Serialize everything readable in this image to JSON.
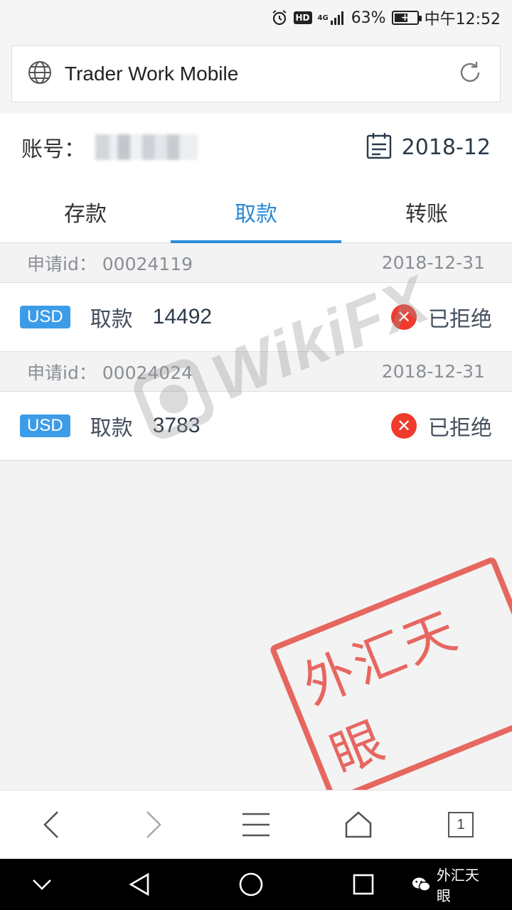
{
  "status_bar": {
    "network": "4G",
    "hd": "HD",
    "battery": "63%",
    "battery_level_percent": 63,
    "time": "中午12:52"
  },
  "browser": {
    "url_title": "Trader Work Mobile",
    "nav_buttons": [
      "back",
      "forward",
      "menu",
      "home",
      "tabs"
    ],
    "tab_count": "1"
  },
  "account": {
    "label": "账号：",
    "date": "2018-12"
  },
  "tabs": [
    {
      "label": "存款",
      "active": false
    },
    {
      "label": "取款",
      "active": true
    },
    {
      "label": "转账",
      "active": false
    }
  ],
  "records": [
    {
      "id_label": "申请id：",
      "id": "00024119",
      "date": "2018-12-31",
      "currency": "USD",
      "type": "取款",
      "amount": "14492",
      "status": "已拒绝"
    },
    {
      "id_label": "申请id：",
      "id": "00024024",
      "date": "2018-12-31",
      "currency": "USD",
      "type": "取款",
      "amount": "3783",
      "status": "已拒绝"
    }
  ],
  "watermarks": {
    "brand": "WikiFX",
    "stamp": "外汇天眼",
    "wechat": "外汇天眼"
  },
  "colors": {
    "accent": "#2a8ad8",
    "badge": "#3d9ce8",
    "reject": "#ef3a2c",
    "stamp": "#e2392f"
  }
}
